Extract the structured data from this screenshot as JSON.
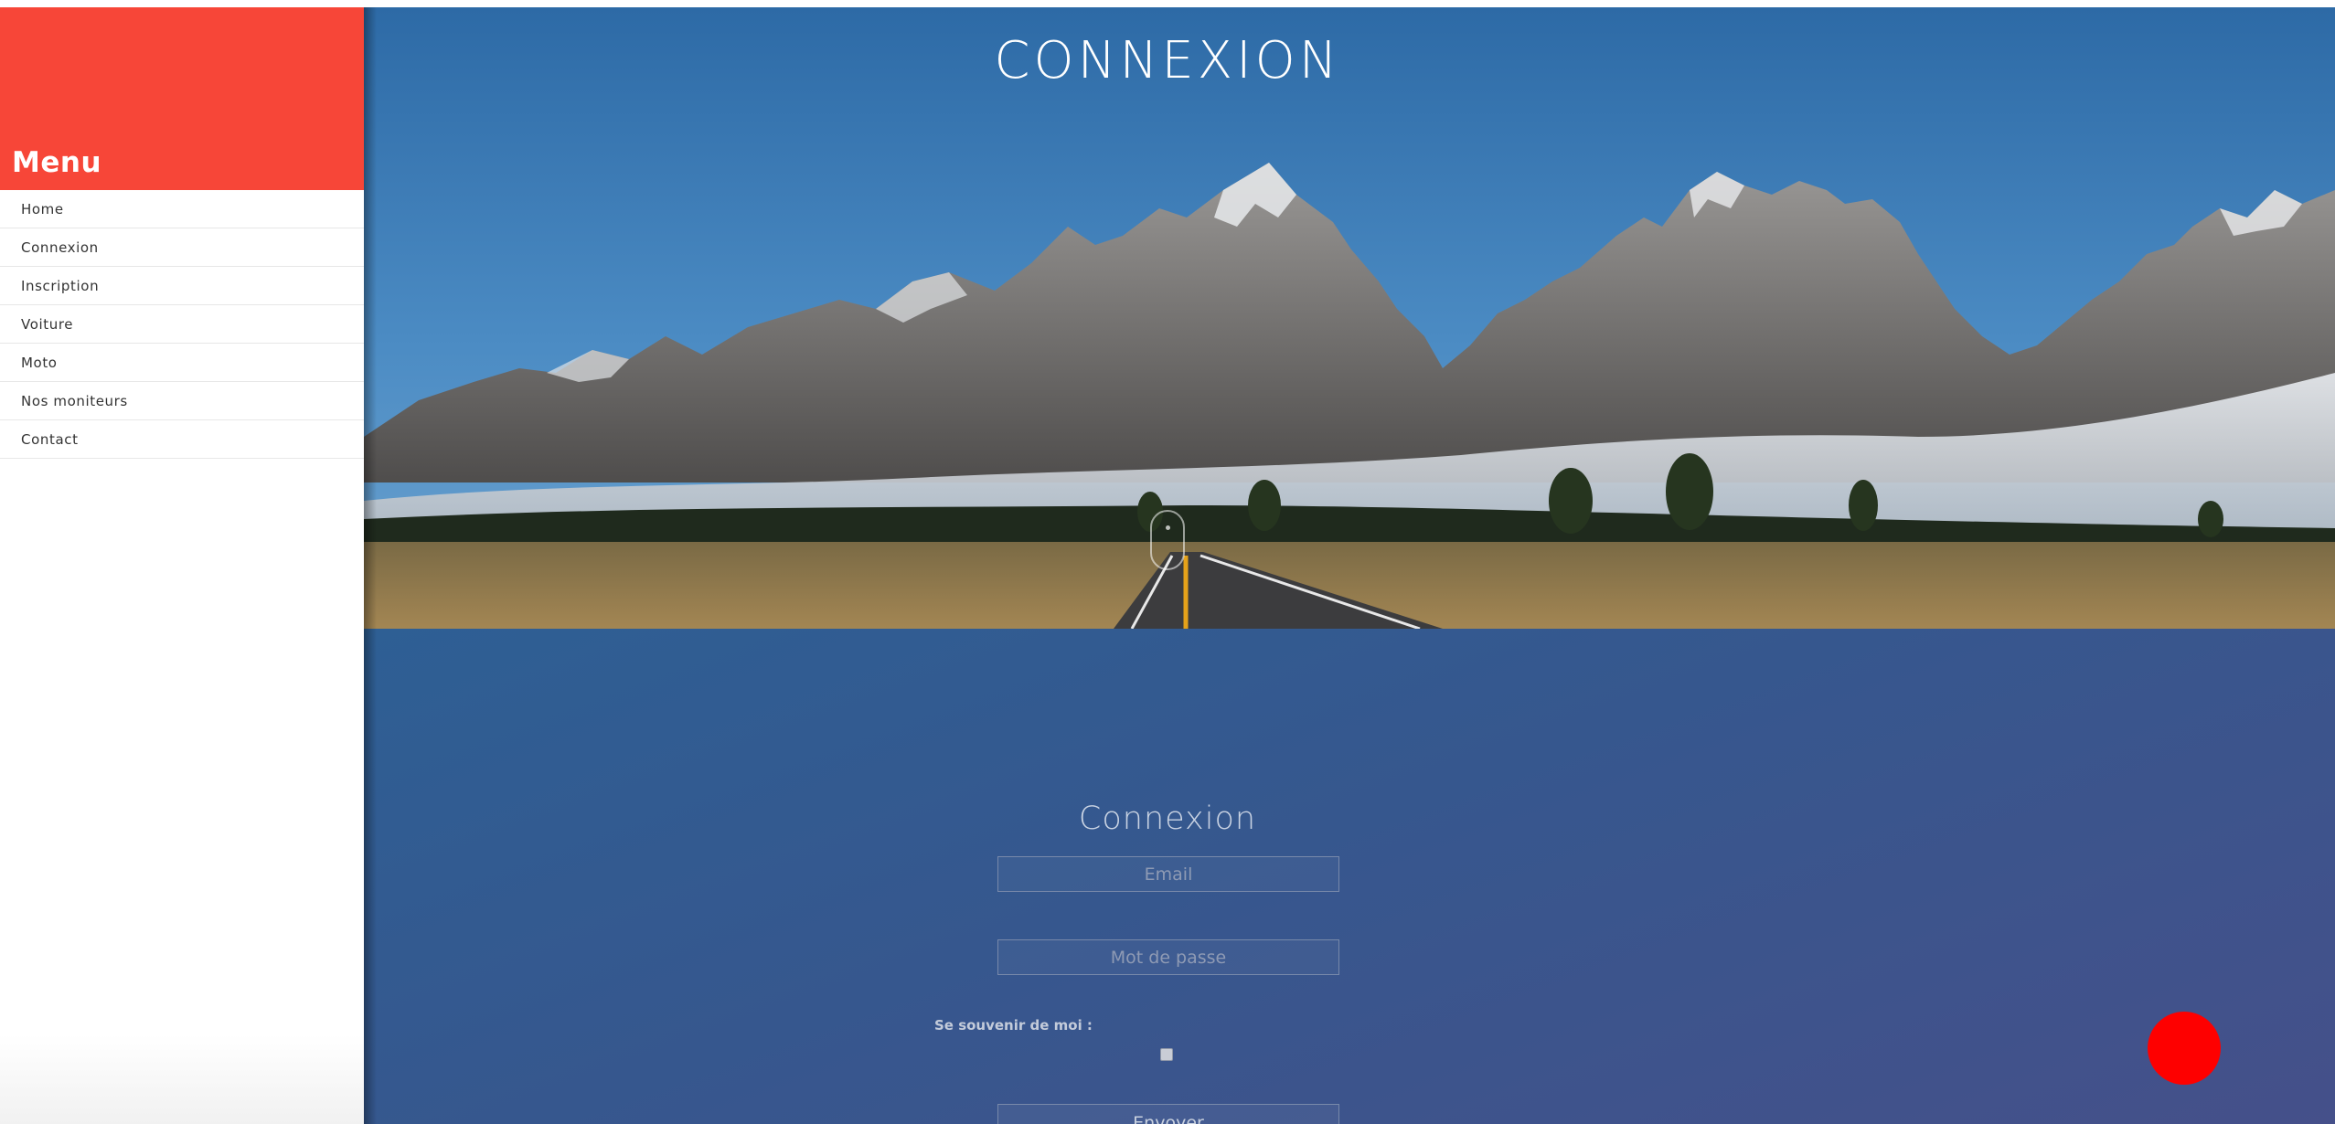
{
  "sidebar": {
    "menu_title": "Menu",
    "items": [
      {
        "label": "Home"
      },
      {
        "label": "Connexion"
      },
      {
        "label": "Inscription"
      },
      {
        "label": "Voiture"
      },
      {
        "label": "Moto"
      },
      {
        "label": "Nos moniteurs"
      },
      {
        "label": "Contact"
      }
    ],
    "accent_color": "#f74638"
  },
  "hero": {
    "title": "CONNEXION",
    "image": "mountain-road-landscape"
  },
  "form": {
    "title": "Connexion",
    "email_placeholder": "Email",
    "password_placeholder": "Mot de passe",
    "remember_label": "Se souvenir de moi :",
    "submit_label": "Envoyer"
  },
  "fab": {
    "color": "#fe0000"
  }
}
